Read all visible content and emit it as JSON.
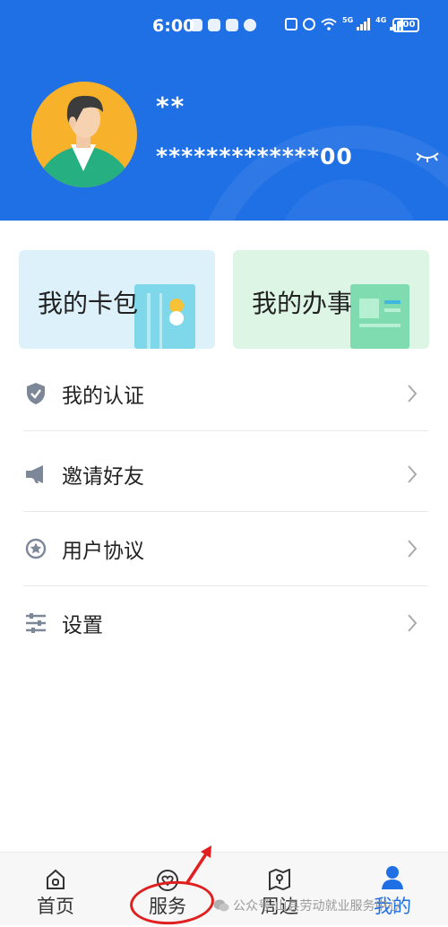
{
  "status_bar": {
    "time": "6:00",
    "network_1": "5G",
    "network_2": "4G",
    "battery": "100"
  },
  "profile": {
    "name": "**",
    "id_number": "*************00"
  },
  "cards": [
    {
      "label": "我的卡包",
      "icon": "card-wallet-icon"
    },
    {
      "label": "我的办事",
      "icon": "affairs-card-icon"
    }
  ],
  "menu": [
    {
      "label": "我的认证",
      "icon": "shield-check-icon"
    },
    {
      "label": "邀请好友",
      "icon": "megaphone-icon"
    },
    {
      "label": "用户协议",
      "icon": "star-badge-icon"
    },
    {
      "label": "设置",
      "icon": "sliders-icon"
    }
  ],
  "bottom_nav": [
    {
      "label": "首页",
      "icon": "home-icon",
      "active": false
    },
    {
      "label": "服务",
      "icon": "heart-service-icon",
      "active": false
    },
    {
      "label": "周边",
      "icon": "map-pin-icon",
      "active": false
    },
    {
      "label": "我的",
      "icon": "person-icon",
      "active": true
    }
  ],
  "watermark": "公众号·山县劳动就业服务中心",
  "colors": {
    "header_bg": "#1f6fe5",
    "accent": "#1f6fe5",
    "wallet_card_bg": "#dcf1fa",
    "affairs_card_bg": "#dcf5e4",
    "annotation_red": "#e02020"
  }
}
